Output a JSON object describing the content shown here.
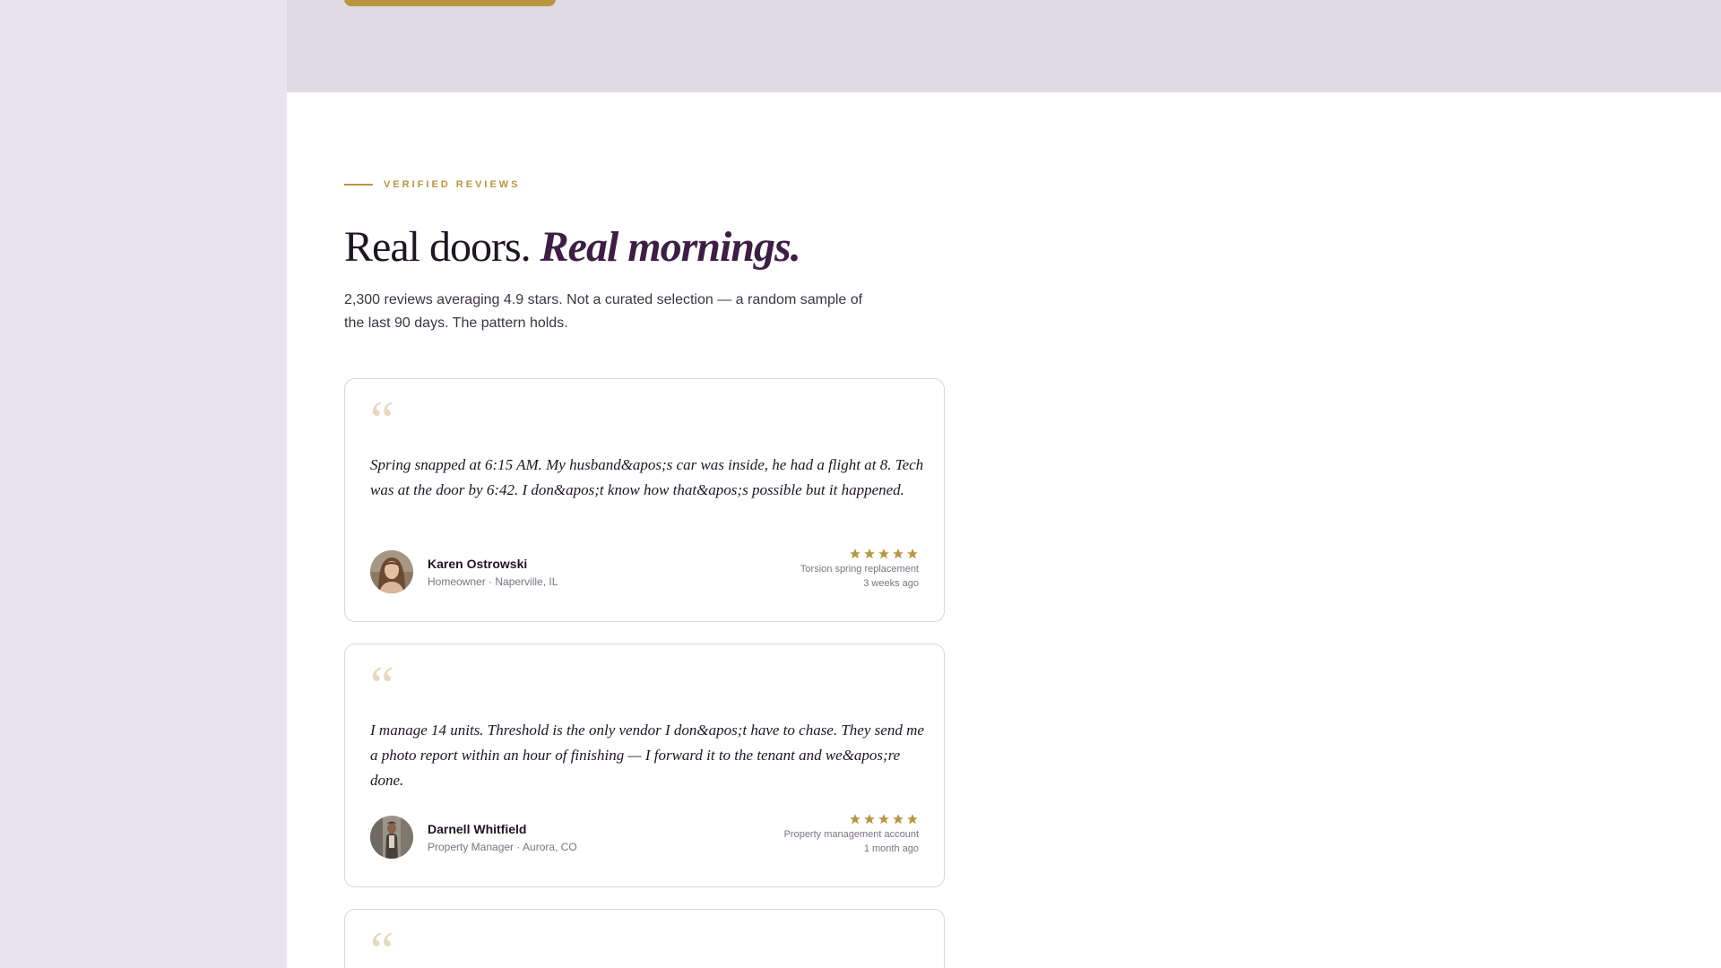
{
  "section": {
    "eyebrow": "VERIFIED REVIEWS",
    "headline_plain": "Real doors. ",
    "headline_em": "Real mornings.",
    "intro": "2,300 reviews averaging 4.9 stars. Not a curated selection — a random sample of the last 90 days. The pattern holds."
  },
  "colors": {
    "gold": "#b9953f",
    "plum": "#3d1e44",
    "band": "#dfdae4"
  },
  "reviews": [
    {
      "quote_glyph": "“",
      "quote": "Spring snapped at 6:15 AM. My husband&apos;s car was inside, he had a flight at 8. Tech was at the door by 6:42. I don&apos;t know how that&apos;s possible but it happened.",
      "name": "Karen Ostrowski",
      "role": "Homeowner · Naperville, IL",
      "rating": 5,
      "service": "Torsion spring replacement",
      "when": "3 weeks ago",
      "avatar_icon": "woman-portrait-icon"
    },
    {
      "quote_glyph": "“",
      "quote": "I manage 14 units. Threshold is the only vendor I don&apos;t have to chase. They send me a photo report within an hour of finishing — I forward it to the tenant and we&apos;re done.",
      "name": "Darnell Whitfield",
      "role": "Property Manager · Aurora, CO",
      "rating": 5,
      "service": "Property management account",
      "when": "1 month ago",
      "avatar_icon": "man-portrait-icon"
    },
    {
      "quote_glyph": "“"
    }
  ]
}
